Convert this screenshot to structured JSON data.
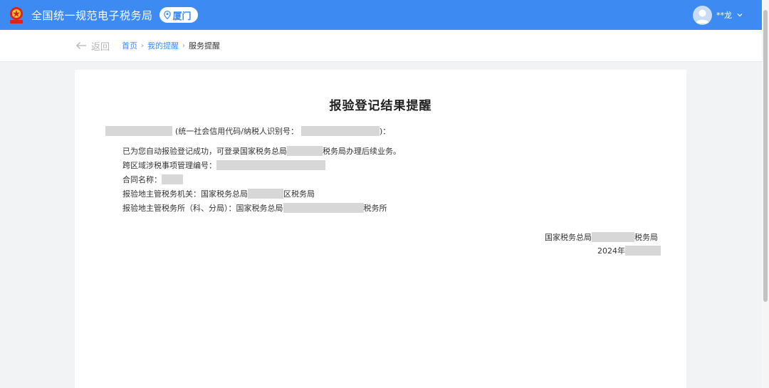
{
  "header": {
    "title": "全国统一规范电子税务局",
    "city": "厦门",
    "user_name": "**龙"
  },
  "nav": {
    "back_label": "返回",
    "breadcrumbs": [
      "首页",
      "我的提醒",
      "服务提醒"
    ]
  },
  "document": {
    "title": "报验登记结果提醒",
    "intro_suffix": "(统一社会信用代码/纳税人识别号：",
    "intro_end": ")：",
    "line1_prefix": "已为您自动报验登记成功，可登录国家税务总局",
    "line1_suffix": "税务局办理后续业务。",
    "line2_label": "跨区域涉税事项管理编号：",
    "line3_label": "合同名称：",
    "line4_prefix": "报验地主管税务机关：国家税务总局",
    "line4_suffix": "区税务局",
    "line5_prefix": "报验地主管税务所（科、分局）：国家税务总局",
    "line5_suffix": "税务所",
    "sign_prefix": "国家税务总局",
    "sign_suffix": "税务局",
    "date_prefix": "2024年"
  },
  "colors": {
    "header_bg": "#3d8bf2",
    "link": "#3d8bf2",
    "redaction": "#d7d7d7"
  }
}
